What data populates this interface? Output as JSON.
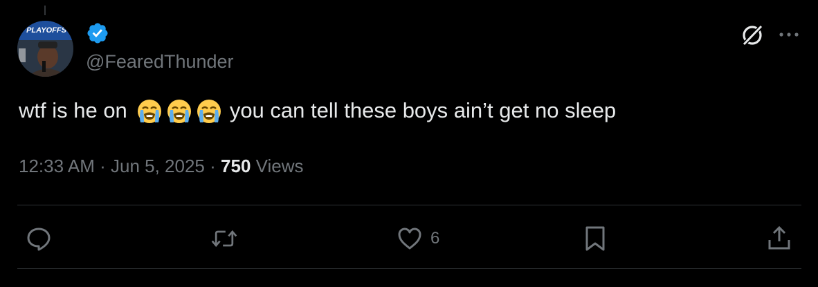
{
  "tweet": {
    "handle": "@FearedThunder",
    "avatar_text": "PLAYOFFS",
    "text_before": "wtf is he on",
    "emojis": [
      "loudly-crying-face",
      "loudly-crying-face",
      "loudly-crying-face"
    ],
    "text_after": "you can tell these boys ain’t get no sleep",
    "time": "12:33 AM",
    "date": "Jun 5, 2025",
    "separator": "·",
    "views_count": "750",
    "views_label": "Views"
  },
  "actions": {
    "reply_count": "",
    "repost_count": "",
    "like_count": "6",
    "bookmark_count": ""
  },
  "colors": {
    "background": "#000000",
    "text": "#e7e9ea",
    "muted": "#71767b",
    "verified": "#1d9bf0",
    "divider": "#2f3336"
  }
}
